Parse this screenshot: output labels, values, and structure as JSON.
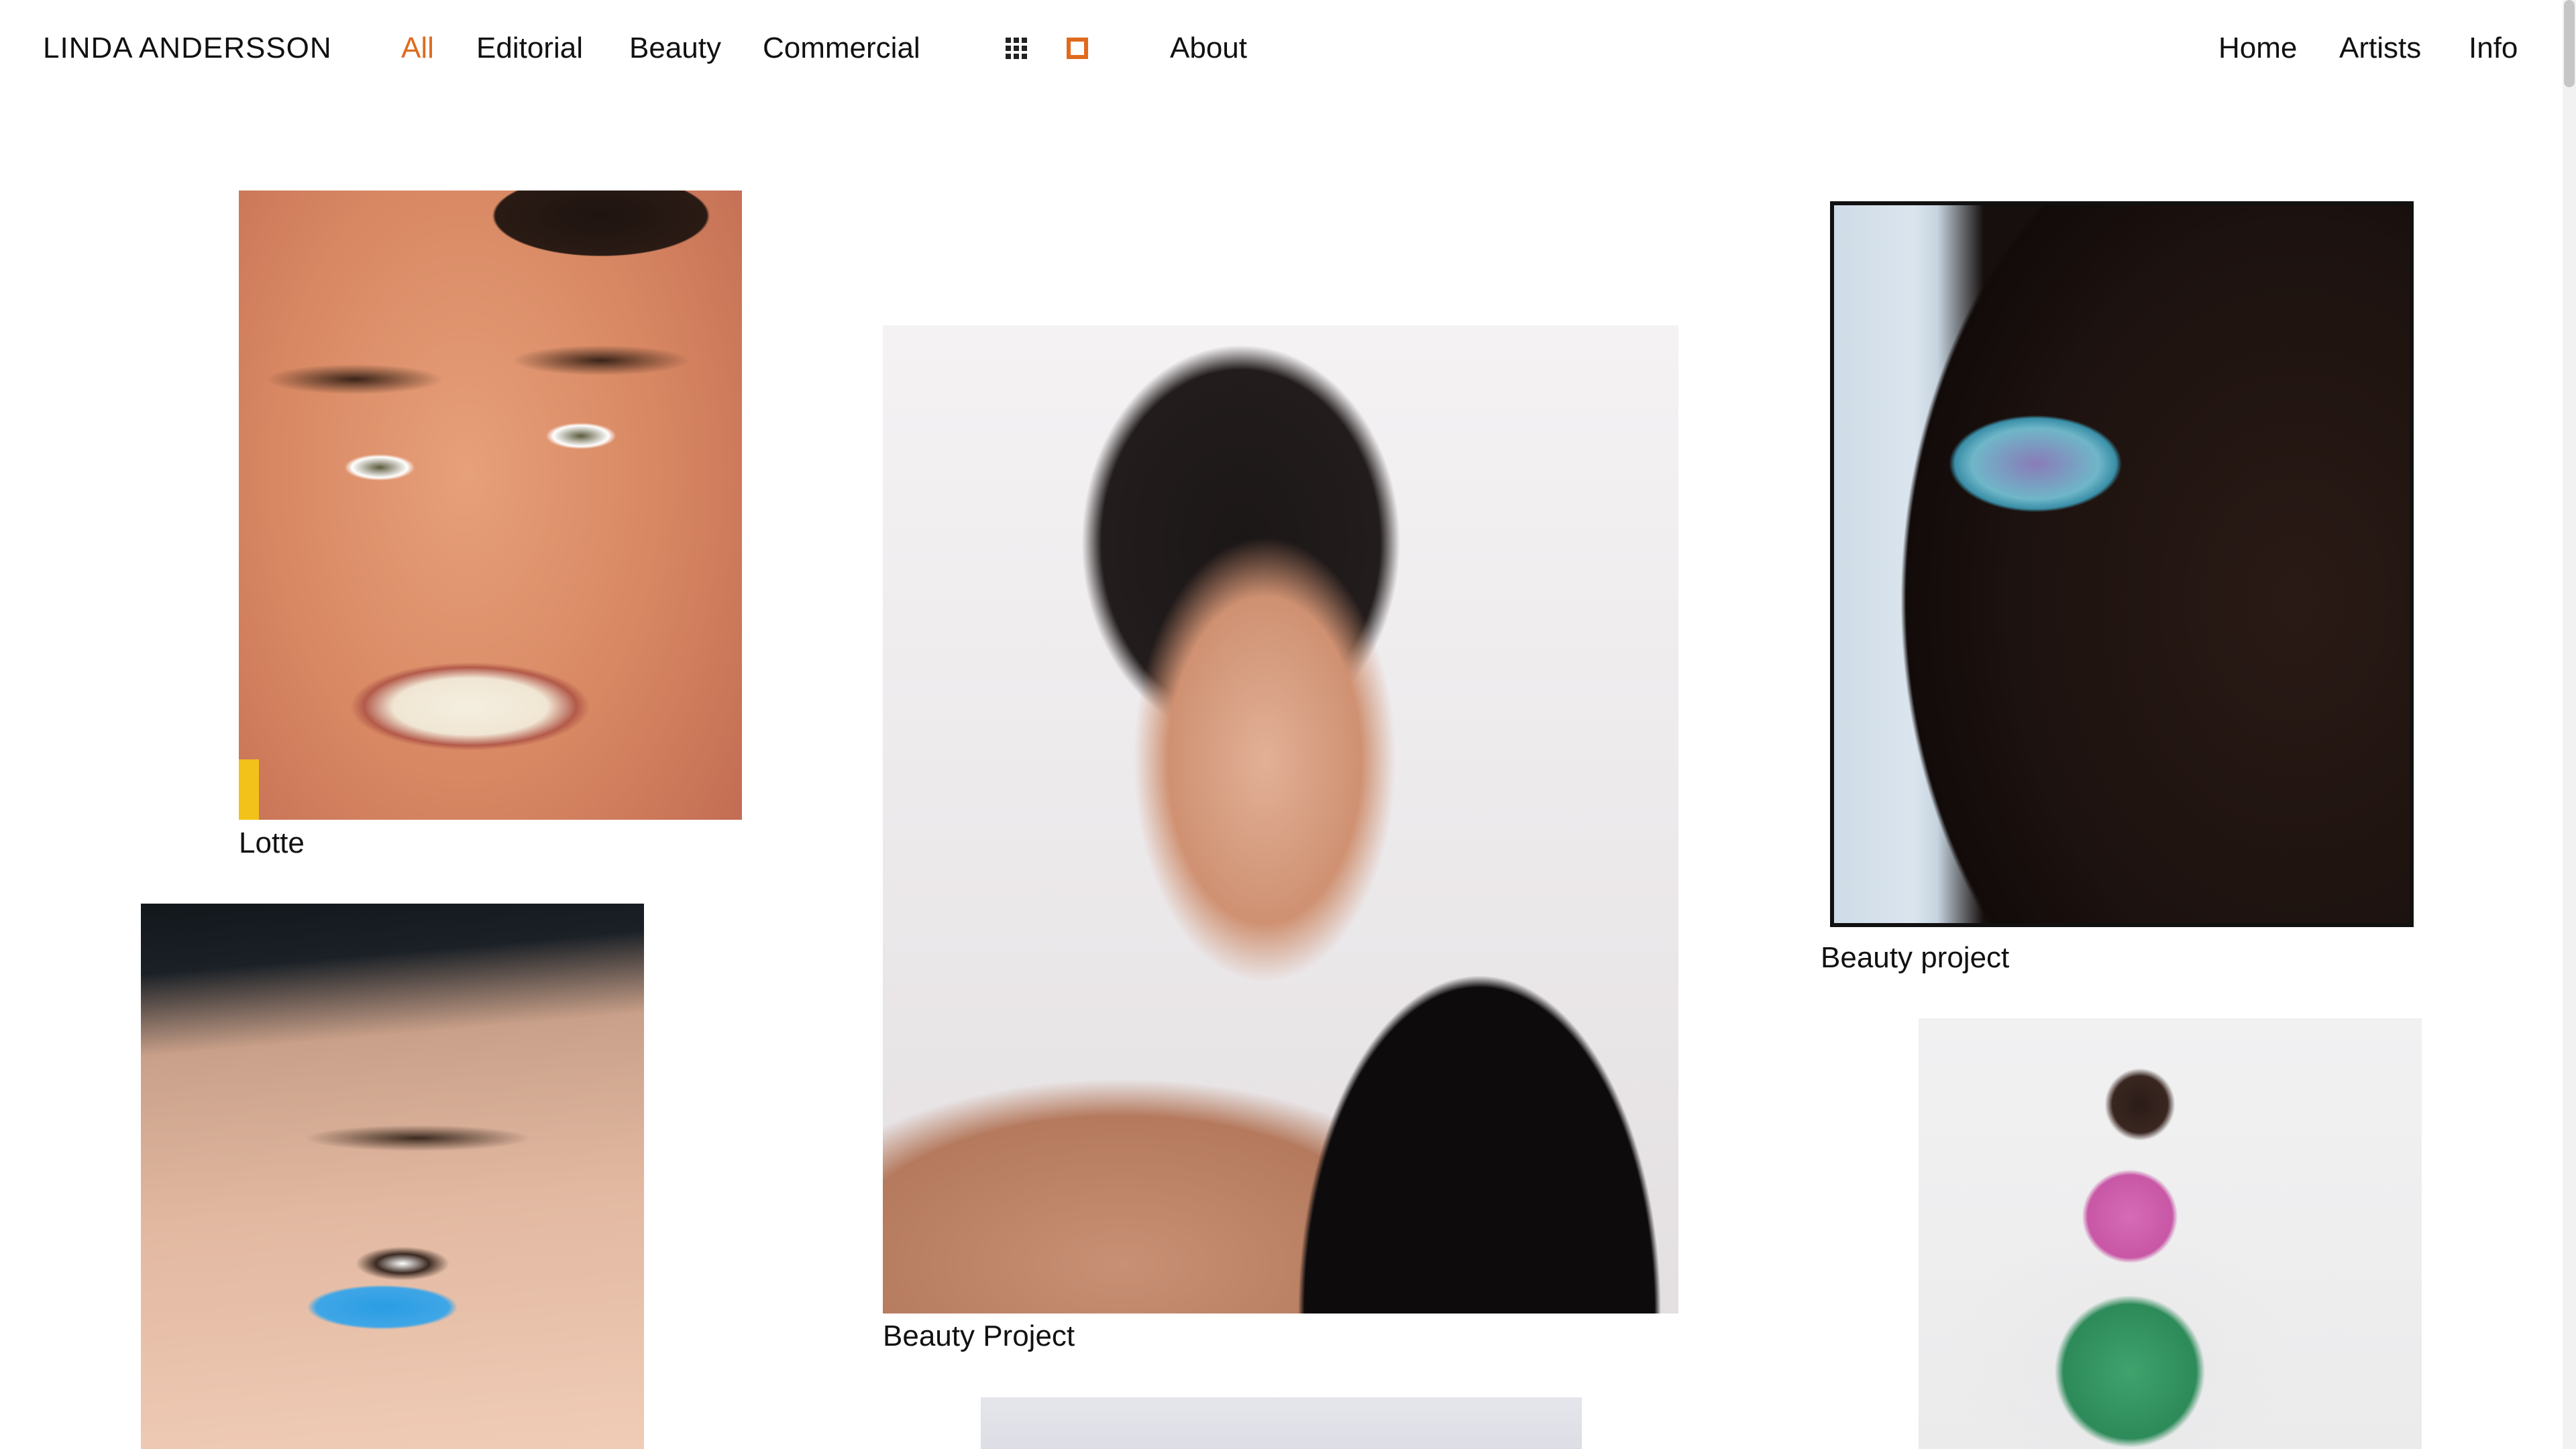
{
  "header": {
    "brand": "LINDA ANDERSSON",
    "categories": [
      {
        "label": "All",
        "active": true
      },
      {
        "label": "Editorial",
        "active": false
      },
      {
        "label": "Beauty",
        "active": false
      },
      {
        "label": "Commercial",
        "active": false
      }
    ],
    "view_toggle": {
      "grid_icon": "grid-view-icon",
      "single_icon": "single-view-icon",
      "active": "single"
    },
    "about": "About",
    "right_nav": [
      "Home",
      "Artists",
      "Info"
    ]
  },
  "colors": {
    "accent": "#e06a1d",
    "text": "#111111",
    "background": "#ffffff"
  },
  "gallery": [
    {
      "caption": "Lotte"
    },
    {
      "caption": "Beauty Project"
    },
    {
      "caption": "Beauty project"
    },
    {
      "caption": ""
    },
    {
      "caption": ""
    },
    {
      "caption": ""
    }
  ]
}
